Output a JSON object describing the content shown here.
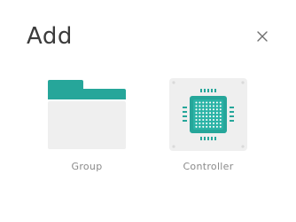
{
  "dialog": {
    "title": "Add",
    "close_icon": "close-icon"
  },
  "items": [
    {
      "label": "Group",
      "icon": "folder-icon"
    },
    {
      "label": "Controller",
      "icon": "chip-icon"
    }
  ],
  "colors": {
    "accent": "#26a69a",
    "tile_background": "#efefef",
    "title_text": "#3b3b3b",
    "label_text": "#8a8a8a"
  }
}
